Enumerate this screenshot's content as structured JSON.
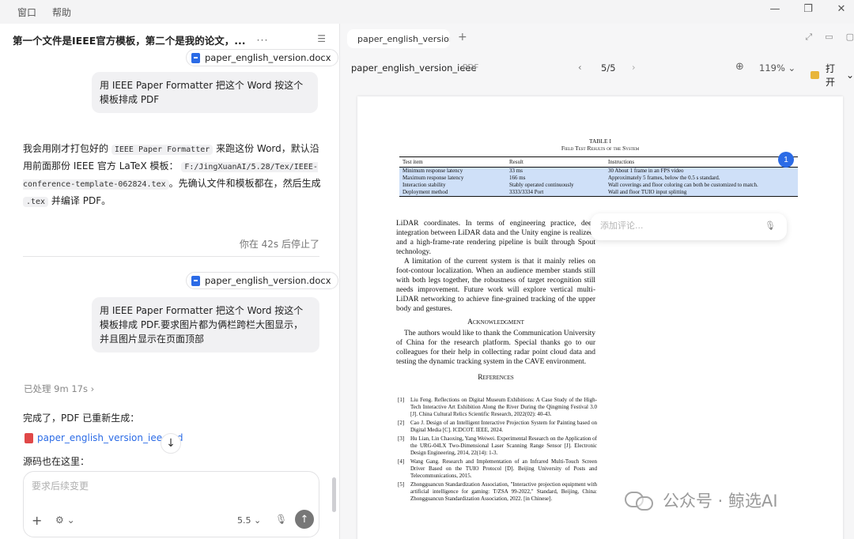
{
  "menubar": {
    "items": [
      "窗口",
      "帮助"
    ]
  },
  "window_controls": {
    "minimize": "—",
    "restore": "❐",
    "close": "✕"
  },
  "chat": {
    "title": "第一个文件是IEEE官方模板，第二个是我的论文，...",
    "attachment1": "paper_english_version.docx",
    "user_msg1": "用 IEEE Paper Formatter 把这个 Word 按这个模板排成 PDF",
    "assistant_msg": {
      "p1": "我会用刚才打包好的",
      "code1": "IEEE Paper Formatter",
      "p2": "来跑这份 Word，默认沿用前面那份 IEEE 官方 LaTeX 模板：",
      "code2": "F:/JingXuanAI/5.28/Tex/IEEE-conference-template-062824.tex",
      "p3": "。先确认文件和模板都在，然后生成",
      "code3": ".tex",
      "p4": "并编译 PDF。"
    },
    "stopped": "你在 42s 后停止了",
    "attachment2": "paper_english_version.docx",
    "user_msg2": "用 IEEE Paper Formatter 把这个 Word 按这个模板排成 PDF.要求图片都为俩栏跨栏大图显示，并且图片显示在页面顶部",
    "processed": "已处理 9m 17s",
    "done": "完成了，PDF 已重新生成：",
    "pdf_link": "paper_english_version_ieee.pd",
    "source": "源码也在这里：",
    "input_placeholder": "要求后续变更",
    "model": "5.5"
  },
  "viewer": {
    "tab_label": "paper_english_version",
    "doc_name": "paper_english_version_ieee",
    "doc_type": "PDF",
    "page_indicator": "5/5",
    "zoom": "119%",
    "open_label": "打开",
    "comment_placeholder": "添加评论...",
    "badge": "1"
  },
  "paper": {
    "table_label": "TABLE I",
    "table_caption": "Field Test Results of the System",
    "table_headers": [
      "Test item",
      "Result",
      "Instructions"
    ],
    "table_rows": [
      [
        "Minimum response latency",
        "33 ms",
        "30 About 1 frame in an FPS video"
      ],
      [
        "Maximum response latency",
        "166 ms",
        "Approximately 5 frames, below the 0.5 s standard."
      ],
      [
        "Interaction stability",
        "Stably operated continuously",
        "Wall coverings and floor coloring can both be customized to match."
      ],
      [
        "Deployment method",
        "3333/3334 Port",
        "Wall and floor TUIO input splitting"
      ]
    ],
    "para1": "LiDAR coordinates. In terms of engineering practice, deep integration between LiDAR data and the Unity engine is realized, and a high-frame-rate rendering pipeline is built through Spout technology.",
    "para2": "A limitation of the current system is that it mainly relies on foot-contour localization. When an audience member stands still with both legs together, the robustness of target recognition still needs improvement. Future work will explore vertical multi-LiDAR networking to achieve fine-grained tracking of the upper body and gestures.",
    "ack_heading": "Acknowledgment",
    "ack_text": "The authors would like to thank the Communication University of China for the research platform. Special thanks go to our colleagues for their help in collecting radar point cloud data and testing the dynamic tracking system in the CAVE environment.",
    "ref_heading": "References",
    "references": [
      {
        "num": "[1]",
        "text": "Liu Feng. Reflections on Digital Museum Exhibitions: A Case Study of the High-Tech Interactive Art Exhibition Along the River During the Qingming Festival 3.0 [J]. China Cultural Relics Scientific Research, 2022(02): 40-43."
      },
      {
        "num": "[2]",
        "text": "Cao J. Design of an Intelligent Interactive Projection System for Painting based on Digital Media [C]. ICDCOT. IEEE, 2024."
      },
      {
        "num": "[3]",
        "text": "Hu Lian, Lin Chaoxing, Yang Weiwei. Experimental Research on the Application of the URG-04LX Two-Dimensional Laser Scanning Range Sensor [J]. Electronic Design Engineering, 2014, 22(14): 1-3."
      },
      {
        "num": "[4]",
        "text": "Wang Gang. Research and Implementation of an Infrared Multi-Touch Screen Driver Based on the TUIO Protocol [D]. Beijing University of Posts and Telecommunications, 2015."
      },
      {
        "num": "[5]",
        "text": "Zhongguancun Standardization Association, \"Interactive projection equipment with artificial intelligence for gaming: T/ZSA 99-2022,\" Standard, Beijing, China: Zhongguancun Standardization Association, 2022. [in Chinese]."
      }
    ]
  },
  "watermark": {
    "text": "公众号 · 鲸选AI"
  }
}
